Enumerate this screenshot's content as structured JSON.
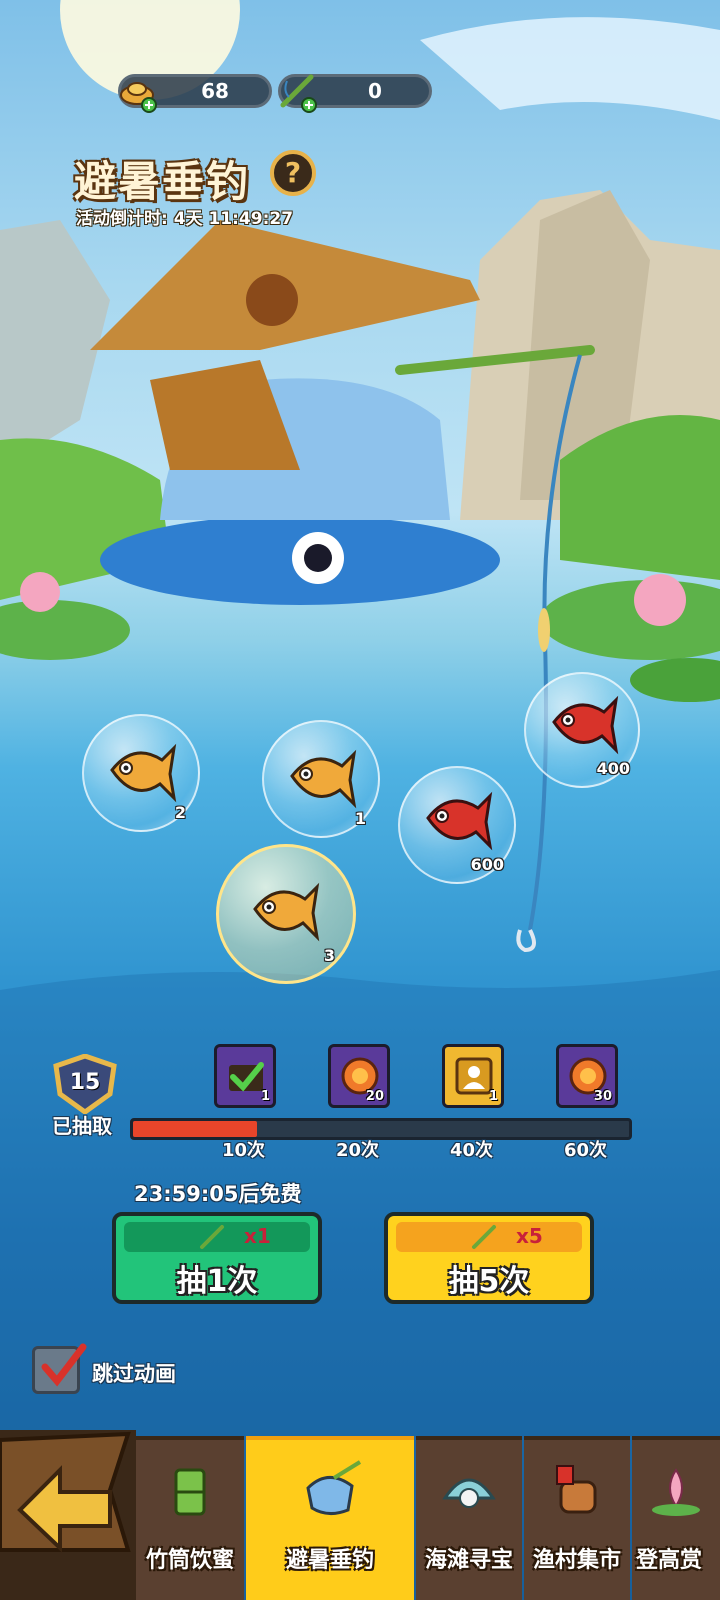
{
  "currencies": [
    {
      "icon": "gold-ingot-icon",
      "value": "68"
    },
    {
      "icon": "fishing-rod-icon",
      "value": "0"
    }
  ],
  "event": {
    "title": "避暑垂钓",
    "help": "?",
    "countdown": "活动倒计时: 4天 11:49:27"
  },
  "fish_bubbles": [
    {
      "icon": "golden-fish-icon",
      "count": "2"
    },
    {
      "icon": "golden-fish-icon",
      "count": "1"
    },
    {
      "icon": "red-fish-icon",
      "count": "600"
    },
    {
      "icon": "red-fish-icon",
      "count": "400"
    },
    {
      "icon": "golden-fish-icon",
      "count": "3"
    }
  ],
  "progress": {
    "draws": "15",
    "drawn_label": "已抽取",
    "fill_fraction": 0.25,
    "milestones": [
      {
        "label": "10次",
        "reward_count": "1"
      },
      {
        "label": "20次",
        "reward_count": "20"
      },
      {
        "label": "40次",
        "reward_count": "1"
      },
      {
        "label": "60次",
        "reward_count": "30"
      }
    ]
  },
  "free_timer": "23:59:05后免费",
  "draw_buttons": [
    {
      "cost": "x1",
      "label": "抽1次",
      "color": "#22c47a"
    },
    {
      "cost": "x5",
      "label": "抽5次",
      "color": "#ffd21e"
    }
  ],
  "skip_animation": {
    "label": "跳过动画",
    "checked": true
  },
  "tabs": [
    {
      "label": "竹筒饮蜜"
    },
    {
      "label": "避暑垂钓",
      "active": true
    },
    {
      "label": "海滩寻宝"
    },
    {
      "label": "渔村集市"
    },
    {
      "label": "登高赏"
    }
  ],
  "colors": {
    "progress_fill": "#e8452a",
    "tab_active": "#ffcc1a"
  }
}
